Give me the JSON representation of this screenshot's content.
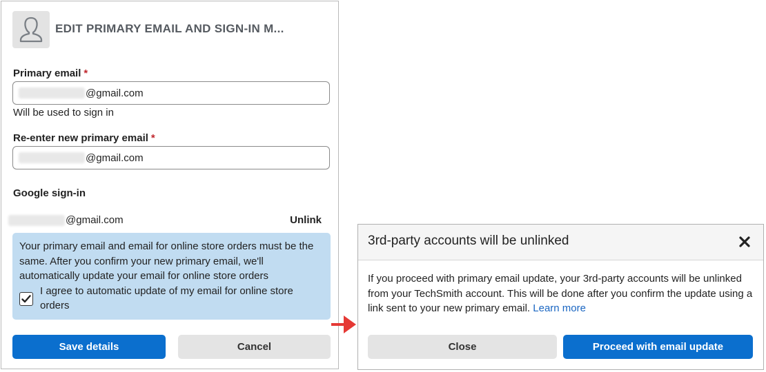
{
  "form": {
    "title": "EDIT PRIMARY EMAIL AND SIGN-IN M...",
    "primary_email_label": "Primary email",
    "required_marker": "*",
    "primary_email_value": "@gmail.com",
    "primary_email_hint": "Will be used to sign in",
    "reenter_label": "Re-enter new primary email",
    "reenter_value": "@gmail.com",
    "google_signin_label": "Google sign-in",
    "google_email": "@gmail.com",
    "unlink_label": "Unlink",
    "info_text": "Your primary email and email for online store orders must be the same. After you confirm your new primary email, we'll automatically update your email for online store orders",
    "agree_text": "I agree to automatic update of my email for online store orders",
    "agree_checked": true,
    "save_label": "Save details",
    "cancel_label": "Cancel"
  },
  "dialog": {
    "title": "3rd-party accounts will be unlinked",
    "body_text": "If you proceed with primary email update, your 3rd-party accounts will be unlinked from your TechSmith account. This will be done after you confirm the update using a link sent to your new primary email.",
    "learn_more": "Learn more",
    "close_label": "Close",
    "proceed_label": "Proceed with email update"
  },
  "icons": {
    "avatar": "user-silhouette-icon",
    "checkbox": "checkmark-icon",
    "close": "close-x-icon",
    "arrow": "red-arrow-icon"
  },
  "colors": {
    "primary_button": "#0b6fce",
    "secondary_button": "#e4e4e4",
    "info_box": "#c1dcf1",
    "required": "#c0282e",
    "link": "#1a66c2",
    "arrow": "#e53935"
  }
}
